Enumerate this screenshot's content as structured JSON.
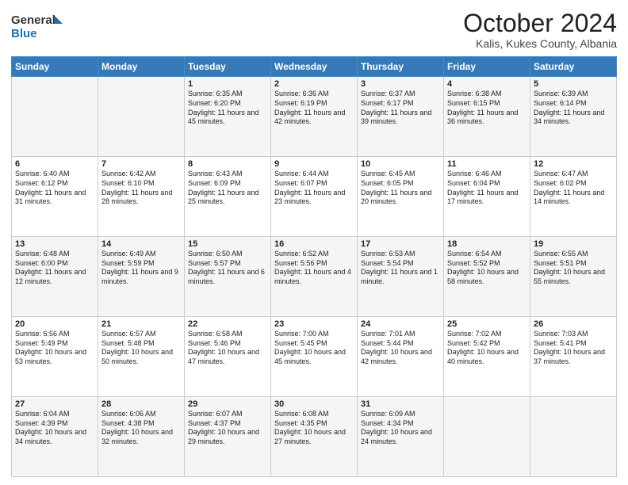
{
  "header": {
    "logo_general": "General",
    "logo_blue": "Blue",
    "month_title": "October 2024",
    "location": "Kalis, Kukes County, Albania"
  },
  "days_of_week": [
    "Sunday",
    "Monday",
    "Tuesday",
    "Wednesday",
    "Thursday",
    "Friday",
    "Saturday"
  ],
  "weeks": [
    [
      {
        "day": "",
        "content": ""
      },
      {
        "day": "",
        "content": ""
      },
      {
        "day": "1",
        "content": "Sunrise: 6:35 AM\nSunset: 6:20 PM\nDaylight: 11 hours and 45 minutes."
      },
      {
        "day": "2",
        "content": "Sunrise: 6:36 AM\nSunset: 6:19 PM\nDaylight: 11 hours and 42 minutes."
      },
      {
        "day": "3",
        "content": "Sunrise: 6:37 AM\nSunset: 6:17 PM\nDaylight: 11 hours and 39 minutes."
      },
      {
        "day": "4",
        "content": "Sunrise: 6:38 AM\nSunset: 6:15 PM\nDaylight: 11 hours and 36 minutes."
      },
      {
        "day": "5",
        "content": "Sunrise: 6:39 AM\nSunset: 6:14 PM\nDaylight: 11 hours and 34 minutes."
      }
    ],
    [
      {
        "day": "6",
        "content": "Sunrise: 6:40 AM\nSunset: 6:12 PM\nDaylight: 11 hours and 31 minutes."
      },
      {
        "day": "7",
        "content": "Sunrise: 6:42 AM\nSunset: 6:10 PM\nDaylight: 11 hours and 28 minutes."
      },
      {
        "day": "8",
        "content": "Sunrise: 6:43 AM\nSunset: 6:09 PM\nDaylight: 11 hours and 25 minutes."
      },
      {
        "day": "9",
        "content": "Sunrise: 6:44 AM\nSunset: 6:07 PM\nDaylight: 11 hours and 23 minutes."
      },
      {
        "day": "10",
        "content": "Sunrise: 6:45 AM\nSunset: 6:05 PM\nDaylight: 11 hours and 20 minutes."
      },
      {
        "day": "11",
        "content": "Sunrise: 6:46 AM\nSunset: 6:04 PM\nDaylight: 11 hours and 17 minutes."
      },
      {
        "day": "12",
        "content": "Sunrise: 6:47 AM\nSunset: 6:02 PM\nDaylight: 11 hours and 14 minutes."
      }
    ],
    [
      {
        "day": "13",
        "content": "Sunrise: 6:48 AM\nSunset: 6:00 PM\nDaylight: 11 hours and 12 minutes."
      },
      {
        "day": "14",
        "content": "Sunrise: 6:49 AM\nSunset: 5:59 PM\nDaylight: 11 hours and 9 minutes."
      },
      {
        "day": "15",
        "content": "Sunrise: 6:50 AM\nSunset: 5:57 PM\nDaylight: 11 hours and 6 minutes."
      },
      {
        "day": "16",
        "content": "Sunrise: 6:52 AM\nSunset: 5:56 PM\nDaylight: 11 hours and 4 minutes."
      },
      {
        "day": "17",
        "content": "Sunrise: 6:53 AM\nSunset: 5:54 PM\nDaylight: 11 hours and 1 minute."
      },
      {
        "day": "18",
        "content": "Sunrise: 6:54 AM\nSunset: 5:52 PM\nDaylight: 10 hours and 58 minutes."
      },
      {
        "day": "19",
        "content": "Sunrise: 6:55 AM\nSunset: 5:51 PM\nDaylight: 10 hours and 55 minutes."
      }
    ],
    [
      {
        "day": "20",
        "content": "Sunrise: 6:56 AM\nSunset: 5:49 PM\nDaylight: 10 hours and 53 minutes."
      },
      {
        "day": "21",
        "content": "Sunrise: 6:57 AM\nSunset: 5:48 PM\nDaylight: 10 hours and 50 minutes."
      },
      {
        "day": "22",
        "content": "Sunrise: 6:58 AM\nSunset: 5:46 PM\nDaylight: 10 hours and 47 minutes."
      },
      {
        "day": "23",
        "content": "Sunrise: 7:00 AM\nSunset: 5:45 PM\nDaylight: 10 hours and 45 minutes."
      },
      {
        "day": "24",
        "content": "Sunrise: 7:01 AM\nSunset: 5:44 PM\nDaylight: 10 hours and 42 minutes."
      },
      {
        "day": "25",
        "content": "Sunrise: 7:02 AM\nSunset: 5:42 PM\nDaylight: 10 hours and 40 minutes."
      },
      {
        "day": "26",
        "content": "Sunrise: 7:03 AM\nSunset: 5:41 PM\nDaylight: 10 hours and 37 minutes."
      }
    ],
    [
      {
        "day": "27",
        "content": "Sunrise: 6:04 AM\nSunset: 4:39 PM\nDaylight: 10 hours and 34 minutes."
      },
      {
        "day": "28",
        "content": "Sunrise: 6:06 AM\nSunset: 4:38 PM\nDaylight: 10 hours and 32 minutes."
      },
      {
        "day": "29",
        "content": "Sunrise: 6:07 AM\nSunset: 4:37 PM\nDaylight: 10 hours and 29 minutes."
      },
      {
        "day": "30",
        "content": "Sunrise: 6:08 AM\nSunset: 4:35 PM\nDaylight: 10 hours and 27 minutes."
      },
      {
        "day": "31",
        "content": "Sunrise: 6:09 AM\nSunset: 4:34 PM\nDaylight: 10 hours and 24 minutes."
      },
      {
        "day": "",
        "content": ""
      },
      {
        "day": "",
        "content": ""
      }
    ]
  ]
}
